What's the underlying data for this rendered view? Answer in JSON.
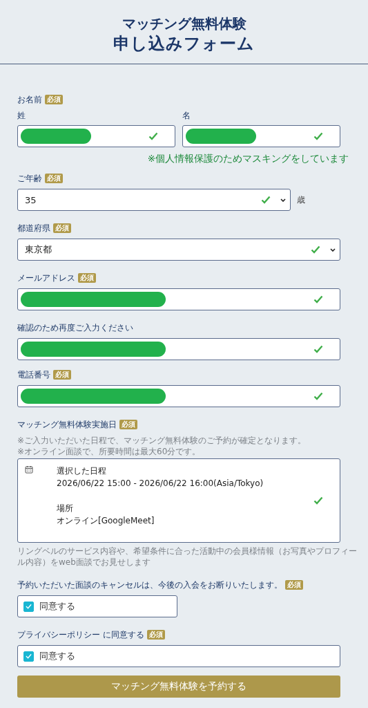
{
  "header": {
    "title_lines": [
      "マッチング無料体験",
      "申し込みフォーム"
    ]
  },
  "sections": [
    {
      "kind": "name",
      "label": "お名前",
      "badge": "必須",
      "fields": [
        {
          "label": "姓",
          "masked": true,
          "valid": true
        },
        {
          "label": "名",
          "masked": true,
          "valid": true
        }
      ],
      "note": "※個人情報保護のためマスキングをしています"
    },
    {
      "kind": "select",
      "label": "ご年齢",
      "badge": "必須",
      "value": "35",
      "valid": true,
      "suffix": "歳"
    },
    {
      "kind": "select",
      "label": "都道府県",
      "badge": "必須",
      "value": "東京都",
      "valid": true
    },
    {
      "kind": "text",
      "label": "メールアドレス",
      "badge": "必須",
      "masked": true,
      "valid": true
    },
    {
      "kind": "text",
      "label": "確認のため再度ご入力ください",
      "masked": true,
      "valid": true
    },
    {
      "kind": "text",
      "label": "電話番号",
      "badge": "必須",
      "masked": true,
      "valid": true
    },
    {
      "kind": "schedule",
      "label": "マッチング無料体験実施日",
      "badge": "必須",
      "notes": [
        "※ご入力いただいた日程で、マッチング無料体験のご予約が確定となります。",
        "※オンライン面談で、所要時間は最大60分です。"
      ],
      "blocks": [
        [
          "選択した日程",
          "2026/06/22 15:00 - 2026/06/22 16:00(Asia/Tokyo)"
        ],
        [
          "場所",
          "オンライン[GoogleMeet]"
        ]
      ],
      "valid": true,
      "footnote": "リングベルのサービス内容や、希望条件に合った活動中の会員様情報（お写真やプロフィール内容）をweb面談でお見せします"
    },
    {
      "kind": "checkbox",
      "label": "予約いただいた面談のキャンセルは、今後の入会をお断りいたします。",
      "badge": "必須",
      "option": "同意する",
      "checked": true
    },
    {
      "kind": "checkbox",
      "label": "プライバシーポリシー に同意する",
      "badge": "必須",
      "option": "同意する",
      "checked": true
    }
  ],
  "submit": {
    "label": "マッチング無料体験を予約する"
  }
}
